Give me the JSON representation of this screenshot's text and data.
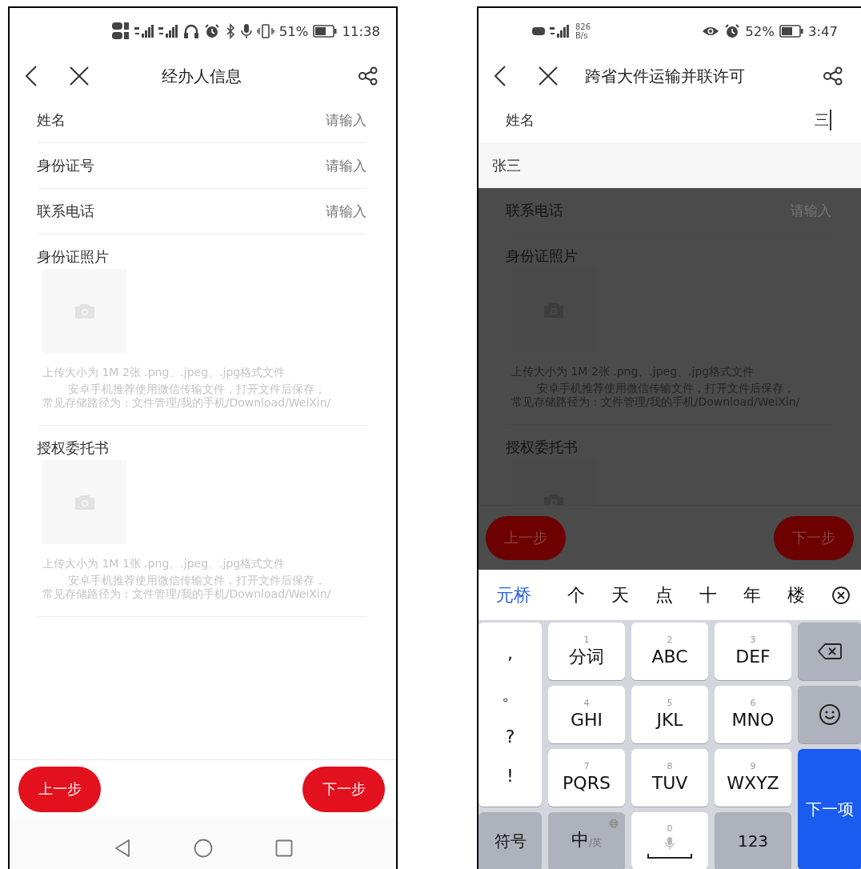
{
  "screens": [
    {
      "status": {
        "battery": "51%",
        "time": "11:38"
      },
      "header": {
        "title": "经办人信息"
      },
      "dimmed": false,
      "fields": [
        {
          "kind": "input",
          "label": "姓名",
          "placeholder": "请输入",
          "focused": false
        },
        {
          "kind": "input",
          "label": "身份证号",
          "placeholder": "请输入",
          "focused": false
        },
        {
          "kind": "input",
          "label": "联系电话",
          "placeholder": "请输入",
          "focused": false
        },
        {
          "kind": "upload",
          "label": "身份证照片",
          "hint": "上传大小为 1M 2张 .png、.jpeg、.jpg格式文件",
          "notes": [
            "安卓手机推荐使用微信传输文件，打开文件后保存，",
            "常见存储路径为：文件管理/我的手机/Download/WeiXin/"
          ]
        },
        {
          "kind": "upload",
          "label": "授权委托书",
          "hint": "上传大小为 1M 1张 .png、.jpeg、.jpg格式文件",
          "notes": [
            "安卓手机推荐使用微信传输文件，打开文件后保存，",
            "常见存储路径为：文件管理/我的手机/Download/WeiXin/"
          ]
        }
      ],
      "buttons": [
        "上一步",
        "下一步"
      ]
    },
    {
      "status": {
        "speed": "826",
        "speed_unit": "B/s",
        "battery": "52%",
        "time": "3:47"
      },
      "header": {
        "title": "跨省大件运输并联许可"
      },
      "dimmed": true,
      "fields": [
        {
          "kind": "input",
          "label": "姓名",
          "value": "三",
          "focused": true
        },
        {
          "kind": "suggestion",
          "text": "张三"
        },
        {
          "kind": "input",
          "label": "联系电话",
          "placeholder": "请输入",
          "focused": false
        },
        {
          "kind": "upload",
          "label": "身份证照片",
          "hint": "上传大小为 1M 2张 .png、.jpeg、.jpg格式文件",
          "notes": [
            "安卓手机推荐使用微信传输文件，打开文件后保存，",
            "常见存储路径为：文件管理/我的手机/Download/WeiXin/"
          ]
        },
        {
          "kind": "upload",
          "label": "授权委托书"
        }
      ],
      "buttons": [
        "上一步",
        "下一步"
      ],
      "keyboard": {
        "candidates": [
          {
            "text": "元桥",
            "selected": true
          },
          {
            "text": "个",
            "selected": false
          },
          {
            "text": "天",
            "selected": false
          },
          {
            "text": "点",
            "selected": false
          },
          {
            "text": "十",
            "selected": false
          },
          {
            "text": "年",
            "selected": false
          },
          {
            "text": "楼",
            "selected": false
          }
        ],
        "keys": [
          {
            "kind": "punct",
            "chars": [
              ",",
              "。",
              "?",
              "!"
            ]
          },
          {
            "kind": "letter",
            "digit": "1",
            "label": "分词"
          },
          {
            "kind": "letter",
            "digit": "2",
            "label": "ABC"
          },
          {
            "kind": "letter",
            "digit": "3",
            "label": "DEF"
          },
          {
            "kind": "backspace"
          },
          {
            "kind": "letter",
            "digit": "4",
            "label": "GHI"
          },
          {
            "kind": "letter",
            "digit": "5",
            "label": "JKL"
          },
          {
            "kind": "letter",
            "digit": "6",
            "label": "MNO"
          },
          {
            "kind": "emoji"
          },
          {
            "kind": "letter",
            "digit": "7",
            "label": "PQRS"
          },
          {
            "kind": "letter",
            "digit": "8",
            "label": "TUV"
          },
          {
            "kind": "letter",
            "digit": "9",
            "label": "WXYZ"
          },
          {
            "kind": "enter",
            "label": "下一项"
          },
          {
            "kind": "function",
            "label": "符号"
          },
          {
            "kind": "lang",
            "label": "中",
            "sub": "/英"
          },
          {
            "kind": "space",
            "digit": "0"
          },
          {
            "kind": "function",
            "label": "123"
          }
        ]
      }
    }
  ]
}
